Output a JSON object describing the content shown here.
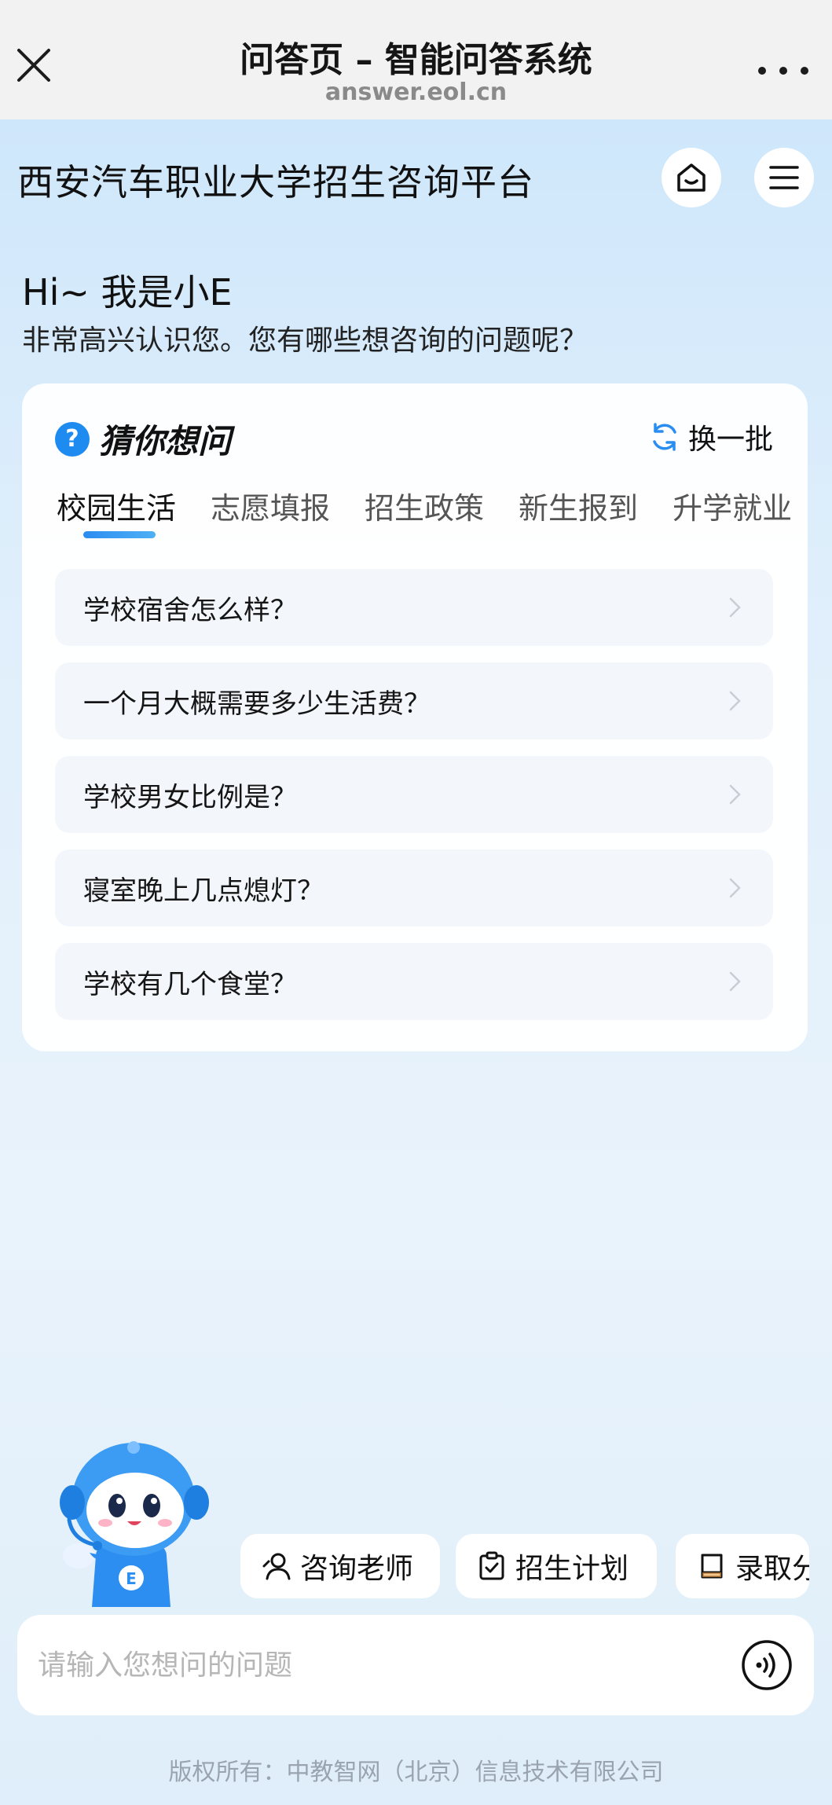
{
  "topbar": {
    "title": "问答页 – 智能问答系统",
    "url": "answer.eol.cn"
  },
  "header": {
    "title": "西安汽车职业大学招生咨询平台"
  },
  "greeting": {
    "hi": "Hi~ 我是小E",
    "sub": "非常高兴认识您。您有哪些想咨询的问题呢？"
  },
  "card": {
    "title": "猜你想问",
    "refresh_label": "换一批",
    "tabs": [
      "校园生活",
      "志愿填报",
      "招生政策",
      "新生报到",
      "升学就业"
    ],
    "active_tab": "校园生活",
    "questions": [
      "学校宿舍怎么样？",
      "一个月大概需要多少生活费？",
      "学校男女比例是？",
      "寝室晚上几点熄灯？",
      "学校有几个食堂？"
    ]
  },
  "quick_buttons": [
    "咨询老师",
    "招生计划",
    "录取分数"
  ],
  "input": {
    "placeholder": "请输入您想问的问题",
    "value": ""
  },
  "footer": {
    "copyright": "版权所有：中教智网（北京）信息技术有限公司"
  },
  "colors": {
    "accent": "#1e8bf0",
    "tab_underline": "#2a8df0",
    "background": "#dcecfa"
  },
  "icons": {
    "close": "close-icon",
    "more": "more-icon",
    "home": "home-icon",
    "menu": "menu-icon",
    "help": "question-icon",
    "refresh": "refresh-icon",
    "chevron": "chevron-right-icon",
    "voice": "voice-icon"
  }
}
